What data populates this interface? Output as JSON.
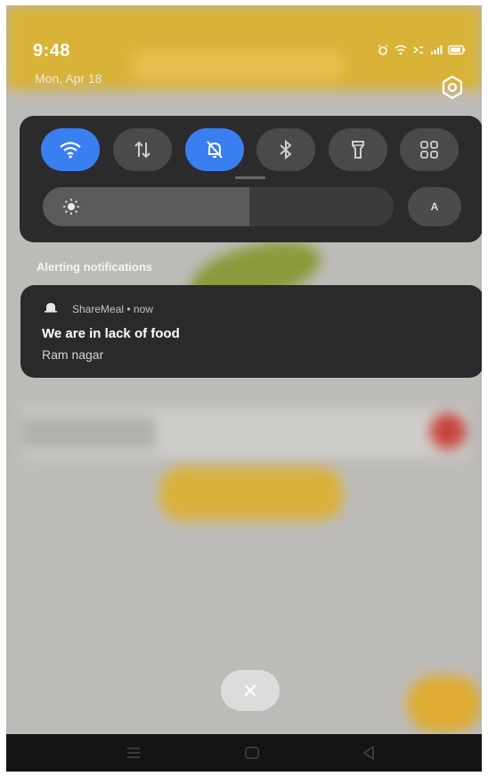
{
  "status_bar": {
    "time": "9:48",
    "date": "Mon, Apr 18",
    "icons": [
      "alarm-icon",
      "wifi-icon",
      "volte-icon",
      "signal-icon",
      "battery-icon"
    ]
  },
  "quick_settings": {
    "tiles": [
      {
        "name": "wifi",
        "icon": "wifi-icon",
        "active": true
      },
      {
        "name": "mobile-data",
        "icon": "mobile-data-icon",
        "active": false
      },
      {
        "name": "do-not-disturb",
        "icon": "bell-off-icon",
        "active": true
      },
      {
        "name": "bluetooth",
        "icon": "bluetooth-icon",
        "active": false
      },
      {
        "name": "flashlight",
        "icon": "flashlight-icon",
        "active": false
      },
      {
        "name": "more-tiles",
        "icon": "grid-icon",
        "active": false
      }
    ],
    "brightness_level": 0.59,
    "auto_brightness_label": "A"
  },
  "notifications": {
    "section_header": "Alerting notifications",
    "items": [
      {
        "app_name": "ShareMeal",
        "time": "now",
        "title": "We are in lack of food",
        "body": "Ram nagar"
      }
    ]
  },
  "colors": {
    "accent": "#3a7ff0",
    "panel": "#2b2b2d",
    "card": "#2a2a2c",
    "background_app_yellow": "#d8b338"
  }
}
